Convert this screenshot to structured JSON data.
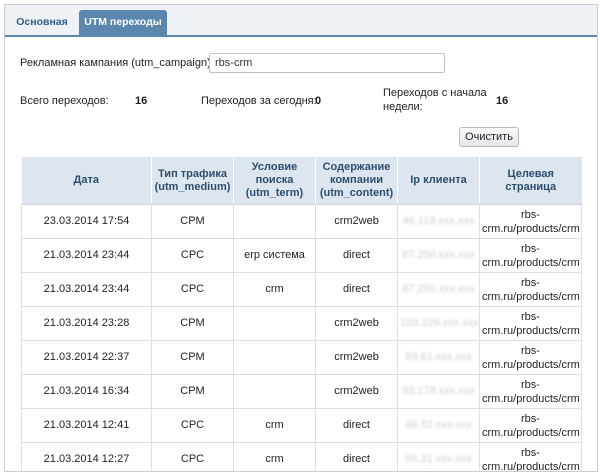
{
  "tabs": [
    {
      "label": "Основная",
      "active": false
    },
    {
      "label": "UTM переходы",
      "active": true
    }
  ],
  "filter": {
    "campaign_label": "Рекламная кампания (utm_campaign):",
    "campaign_value": "rbs-crm"
  },
  "stats": {
    "total_label": "Всего переходов:",
    "total_value": "16",
    "today_label": "Переходов за сегодня:",
    "today_value": "0",
    "week_label_line1": "Переходов с начала",
    "week_label_line2": "недели:",
    "week_value": "16"
  },
  "clear_button": "Очистить",
  "table": {
    "headers": [
      {
        "line1": "Дата",
        "line2": ""
      },
      {
        "line1": "Тип трафика",
        "line2": "(utm_medium)"
      },
      {
        "line1": "Условие поиска",
        "line2": "(utm_term)"
      },
      {
        "line1": "Содержание компании",
        "line2": "(utm_content)"
      },
      {
        "line1": "Ip клиента",
        "line2": ""
      },
      {
        "line1": "Целевая страница",
        "line2": ""
      }
    ],
    "rows": [
      {
        "date": "23.03.2014 17:54",
        "medium": "CPM",
        "term": "",
        "content": "crm2web",
        "ip": "46.118.xxx.xxx",
        "target1": "rbs-",
        "target2": "crm.ru/products/crm"
      },
      {
        "date": "21.03.2014 23:44",
        "medium": "CPC",
        "term": "erp система",
        "content": "direct",
        "ip": "87.250.xxx.xxx",
        "target1": "rbs-",
        "target2": "crm.ru/products/crm"
      },
      {
        "date": "21.03.2014 23:44",
        "medium": "CPC",
        "term": "crm",
        "content": "direct",
        "ip": "87.250.xxx.xxx",
        "target1": "rbs-",
        "target2": "crm.ru/products/crm"
      },
      {
        "date": "21.03.2014 23:28",
        "medium": "CPM",
        "term": "",
        "content": "crm2web",
        "ip": "109.229.xxx.xxx",
        "target1": "rbs-",
        "target2": "crm.ru/products/crm"
      },
      {
        "date": "21.03.2014 22:37",
        "medium": "CPM",
        "term": "",
        "content": "crm2web",
        "ip": "93.81.xxx.xxx",
        "target1": "rbs-",
        "target2": "crm.ru/products/crm"
      },
      {
        "date": "21.03.2014 16:34",
        "medium": "CPM",
        "term": "",
        "content": "crm2web",
        "ip": "93.178.xxx.xxx",
        "target1": "rbs-",
        "target2": "crm.ru/products/crm"
      },
      {
        "date": "21.03.2014 12:41",
        "medium": "CPC",
        "term": "crm",
        "content": "direct",
        "ip": "46.52.xxx.xxx",
        "target1": "rbs-",
        "target2": "crm.ru/products/crm"
      },
      {
        "date": "21.03.2014 12:27",
        "medium": "CPC",
        "term": "crm",
        "content": "direct",
        "ip": "95.31.xxx.xxx",
        "target1": "rbs-",
        "target2": "crm.ru/products/crm"
      }
    ]
  }
}
